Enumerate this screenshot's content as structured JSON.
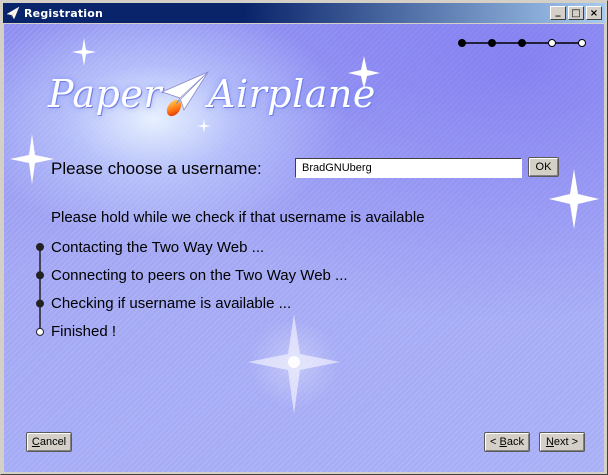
{
  "window": {
    "title": "Registration",
    "minimize_glyph": "_",
    "maximize_glyph": "□",
    "close_glyph": "×"
  },
  "logo": {
    "word_left": "Paper",
    "word_right": "Airplane"
  },
  "steps": {
    "total": 5,
    "current": 3
  },
  "form": {
    "prompt": "Please choose a username:",
    "username_value": "BradGNUberg",
    "ok_label": "OK"
  },
  "status": {
    "hold_text": "Please hold while we check if that username is available",
    "items": [
      {
        "label": "Contacting the Two Way Web ...",
        "done": true
      },
      {
        "label": "Connecting to peers on the Two Way Web ...",
        "done": true
      },
      {
        "label": "Checking if username is available ...",
        "done": true
      },
      {
        "label": "Finished !",
        "done": false
      }
    ]
  },
  "buttons": {
    "cancel_first": "C",
    "cancel_rest": "ancel",
    "back_prefix": "< ",
    "back_first": "B",
    "back_rest": "ack",
    "next_first": "N",
    "next_rest": "ext >"
  },
  "colors": {
    "title_bar": "#0a246a",
    "background": "#9a9df0",
    "step_dot": "#000000"
  }
}
